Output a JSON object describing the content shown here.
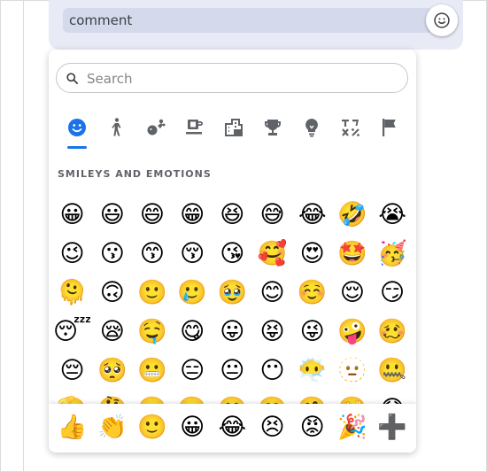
{
  "comment": {
    "value": "comment"
  },
  "picker": {
    "search": {
      "placeholder": "Search"
    },
    "tabs": [
      {
        "name": "smileys",
        "icon": "smiley-icon",
        "active": true
      },
      {
        "name": "people",
        "icon": "person-icon"
      },
      {
        "name": "animals-nature",
        "icon": "animals-nature-icon"
      },
      {
        "name": "food-drink",
        "icon": "coffee-icon"
      },
      {
        "name": "travel-places",
        "icon": "city-icon"
      },
      {
        "name": "activities",
        "icon": "trophy-icon"
      },
      {
        "name": "objects",
        "icon": "lightbulb-icon"
      },
      {
        "name": "symbols",
        "icon": "symbols-icon"
      },
      {
        "name": "flags",
        "icon": "flag-icon"
      }
    ],
    "section_title": "SMILEYS AND EMOTIONS",
    "emojis": [
      [
        "😀",
        "😃",
        "😄",
        "😁",
        "😆",
        "😅",
        "😂",
        "🤣",
        "😭"
      ],
      [
        "😉",
        "😗",
        "😙",
        "😚",
        "😘",
        "🥰",
        "😍",
        "🤩",
        "🥳"
      ],
      [
        "🫠",
        "🙃",
        "🙂",
        "🥲",
        "🥹",
        "😊",
        "☺️",
        "😌",
        "😏"
      ],
      [
        "😴",
        "😪",
        "🤤",
        "😋",
        "😛",
        "😝",
        "😜",
        "🤪",
        "🥴"
      ],
      [
        "😔",
        "🥺",
        "😬",
        "😑",
        "😐",
        "😶",
        "😶‍🌫️",
        "🫥",
        "🤐"
      ],
      [
        "🫡",
        "🤔",
        "🤫",
        "🫢",
        "🤭",
        "🥱",
        "🤗",
        "🫣",
        "😱"
      ]
    ],
    "recent": [
      "👍",
      "👏",
      "🙂",
      "😀",
      "😂",
      "😣",
      "😡",
      "🎉",
      "➕"
    ]
  },
  "colors": {
    "accent": "#1a73e8",
    "tab_icon": "#5f6368",
    "bubble": "#e8eaf6"
  }
}
